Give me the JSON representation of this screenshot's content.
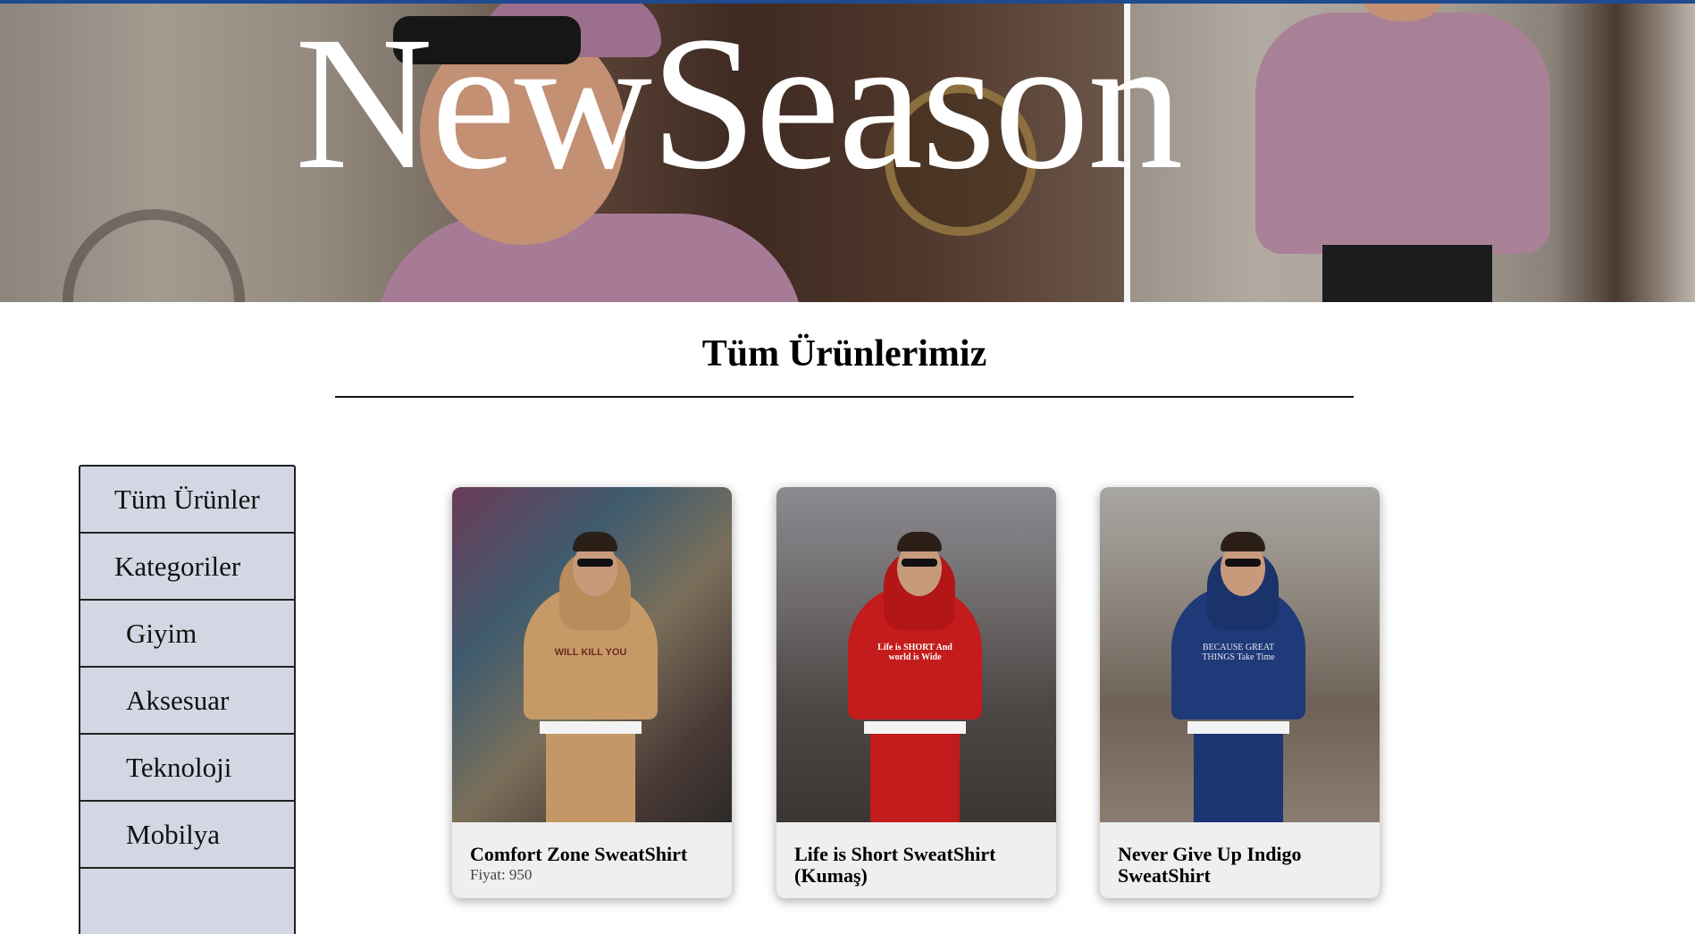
{
  "hero": {
    "title": "NewSeason"
  },
  "section": {
    "title": "Tüm Ürünlerimiz"
  },
  "sidebar": {
    "items": [
      {
        "label": "Tüm Ürünler"
      },
      {
        "label": "Kategoriler"
      },
      {
        "label": "Giyim"
      },
      {
        "label": "Aksesuar"
      },
      {
        "label": "Teknoloji"
      },
      {
        "label": "Mobilya"
      },
      {
        "label": ""
      }
    ]
  },
  "products": [
    {
      "name": "Comfort Zone SweatShirt",
      "price": "Fiyat: 950",
      "image_print": "WILL KILL YOU"
    },
    {
      "name": "Life is Short SweatShirt (Kumaş)",
      "price": "",
      "image_print": "Life is SHORT And world is Wide"
    },
    {
      "name": "Never Give Up Indigo SweatShirt",
      "price": "",
      "image_print": "BECAUSE GREAT THINGS Take Time"
    }
  ],
  "colors": {
    "top_stripe": "#1f4a8f",
    "sidebar_bg": "#d3d7e3",
    "card_bg": "#efefef"
  }
}
